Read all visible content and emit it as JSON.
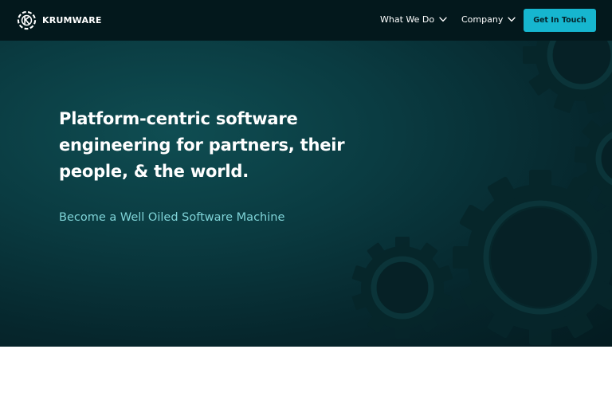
{
  "brand": {
    "name": "KRUMWARE",
    "logo_icon": "krumware-logo-icon"
  },
  "nav": {
    "items": [
      {
        "label": "What We Do",
        "icon": "chevron-down-icon"
      },
      {
        "label": "Company",
        "icon": "chevron-down-icon"
      }
    ],
    "cta_label": "Get In Touch"
  },
  "hero": {
    "headline": "Platform-centric software engineering for partners, their people, & the world.",
    "subheadline": "Become a Well Oiled Software Machine",
    "decoration_icon": "gears-icon"
  },
  "colors": {
    "nav_bg": "#03181c",
    "accent": "#16b6cf",
    "hero_bg": "#0a3b41",
    "subheadline": "#7fd4d8"
  }
}
